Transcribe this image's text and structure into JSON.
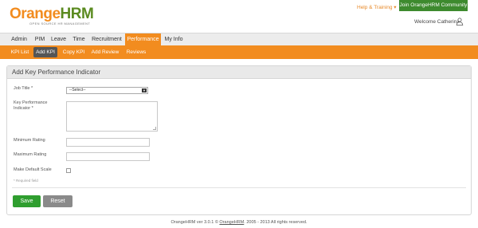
{
  "header": {
    "logo_main_1": "Orange",
    "logo_main_2": "HRM",
    "logo_tagline": "OPEN SOURCE HR MANAGEMENT",
    "help_link": "Help & Training",
    "help_arrow": "▾",
    "join_button": "Join OrangeHRM Community",
    "welcome_text": "Welcome Catherina"
  },
  "main_menu": {
    "items": [
      "Admin",
      "PIM",
      "Leave",
      "Time",
      "Recruitment",
      "Performance",
      "My Info"
    ],
    "active": "Performance"
  },
  "sub_menu": {
    "items": [
      "KPI List",
      "Add KPI",
      "Copy KPI",
      "Add Review",
      "Reviews"
    ],
    "active": "Add KPI"
  },
  "form": {
    "title": "Add Key Performance Indicator",
    "job_title_label": "Job Title *",
    "job_title_value": "--Select--",
    "kpi_label_line1": "Key Performance",
    "kpi_label_line2": "Indicator *",
    "min_rating_label": "Minimum Rating",
    "max_rating_label": "Maximum Rating",
    "default_scale_label": "Make Default Scale",
    "required_note": "* Required field",
    "save_button": "Save",
    "reset_button": "Reset"
  },
  "footer": {
    "prefix": "OrangeHRM ver 3.0.1 © ",
    "link": "OrangeHRM",
    "suffix": ". 2005 - 2013 All rights reserved."
  },
  "colors": {
    "brand_orange": "#f28c1f",
    "brand_green": "#3d8a2e",
    "save_green": "#2f9e2f",
    "reset_gray": "#8a8a8a"
  },
  "icons": {
    "user_icon": "user-icon",
    "dropdown_arrow": "chevron-down-icon"
  }
}
